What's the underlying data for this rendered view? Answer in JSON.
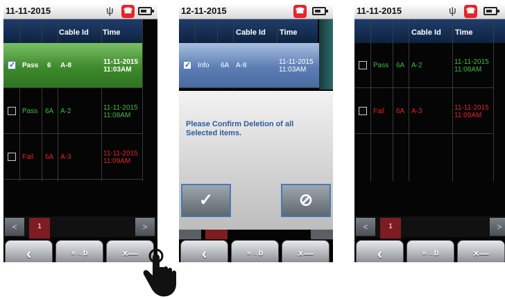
{
  "screen1": {
    "date": "11-11-2015",
    "columns": [
      "",
      "",
      "",
      "Cable Id",
      "Time"
    ],
    "rows": [
      {
        "status": "Pass",
        "cat": "6",
        "cable": "A-8",
        "time1": "11-11-2015",
        "time2": "11:03AM",
        "checked": true
      },
      {
        "status": "Pass",
        "cat": "6A",
        "cable": "A-2",
        "time1": "11-11-2015",
        "time2": "11:08AM",
        "checked": false
      },
      {
        "status": "Fail",
        "cat": "6A",
        "cable": "A-3",
        "time1": "11-11-2015",
        "time2": "11:09AM",
        "checked": false
      }
    ],
    "pager": {
      "prev": "<",
      "page": "1",
      "next": ">"
    },
    "buttons": {
      "back": "‹",
      "transfer": "»→b",
      "delete": "×—"
    }
  },
  "screen2": {
    "date": "12-11-2015",
    "columns": [
      "",
      "",
      "",
      "Cable Id",
      "Time"
    ],
    "rows": [
      {
        "status": "Info",
        "cat": "6A",
        "cable": "A-8",
        "time1": "11-11-2015",
        "time2": "11:03AM",
        "checked": true
      }
    ],
    "dialog": {
      "message": "Please Confirm Deletion of all Selected items.",
      "confirm": "✓",
      "cancel": "⊘"
    },
    "buttons": {
      "back": "‹",
      "transfer": "»→b",
      "delete": "×—"
    }
  },
  "screen3": {
    "date": "11-11-2015",
    "columns": [
      "",
      "",
      "",
      "Cable Id",
      "Time"
    ],
    "rows": [
      {
        "status": "Pass",
        "cat": "6A",
        "cable": "A-2",
        "time1": "11-11-2015",
        "time2": "11:08AM",
        "checked": false
      },
      {
        "status": "Fail",
        "cat": "6A",
        "cable": "A-3",
        "time1": "11-11-2015",
        "time2": "11:09AM",
        "checked": false
      }
    ],
    "pager": {
      "prev": "<",
      "page": "1",
      "next": ">"
    },
    "buttons": {
      "back": "‹",
      "transfer": "»→b",
      "delete": "×—"
    }
  },
  "colors": {
    "pass": "#3fbf3f",
    "fail": "#e62525",
    "selected_green": "#3e8a2c",
    "selected_blue": "#5d7eb5",
    "header": "#1f3d6a",
    "page_active": "#7d1d22"
  },
  "icons": {
    "usb": "usb-icon",
    "phone": "phone-hangup-icon",
    "battery": "battery-icon"
  }
}
